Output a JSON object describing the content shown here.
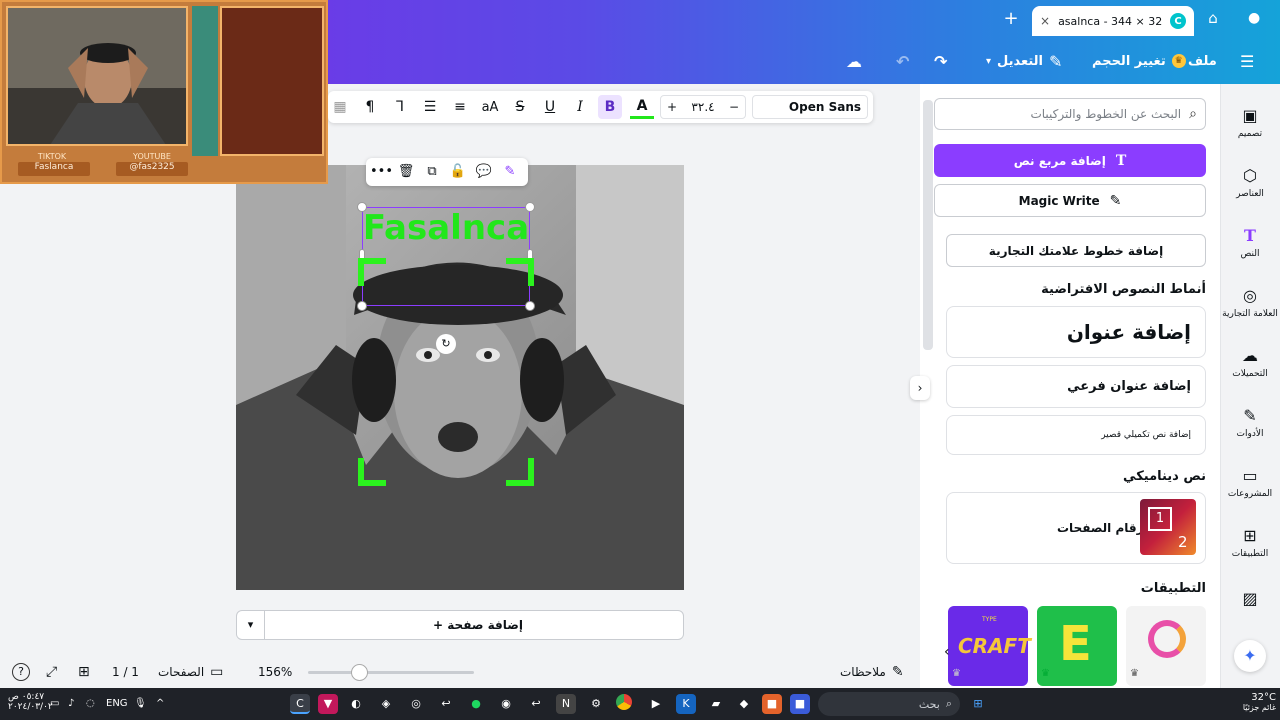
{
  "browser": {
    "tab_title": "asalnca - 344 × 326...",
    "new_tab": "+",
    "close": "×"
  },
  "topbar": {
    "file": "ملف",
    "resize": "تغيير الحجم",
    "edit": "التعديل"
  },
  "toolbar": {
    "font_name": "Open Sans",
    "font_size": "٣٢.٤",
    "minus": "−",
    "plus": "+",
    "text_color_glyph": "A",
    "bold_glyph": "B",
    "italic_glyph": "I",
    "underline_glyph": "U",
    "strike_glyph": "S",
    "case_glyph": "aA"
  },
  "canvas": {
    "brand_text": "Fasalnca",
    "add_page": "+ إضافة صفحة"
  },
  "bottombar": {
    "notes": "ملاحظات",
    "zoom": "156%",
    "pages_label": "الصفحات",
    "pages_count": "1 / 1"
  },
  "webcam": {
    "tiktok_label": "TIKTOK",
    "youtube_label": "YOUTUBE",
    "tiktok_name": "Faslanca",
    "youtube_name": "@fas2325"
  },
  "panel": {
    "search_placeholder": "البحث عن الخطوط والتركيبات",
    "add_textbox": "إضافة مربع نص",
    "magic_write": "Magic Write",
    "brand_fonts": "إضافة خطوط علامتك التجارية",
    "default_styles_title": "أنماط النصوص الافتراضية",
    "heading": "إضافة عنوان",
    "subheading": "إضافة عنوان فرعي",
    "body": "إضافة نص تكميلي قصير",
    "dynamic_title": "نص ديناميكي",
    "page_numbers": "أرقام الصفحات",
    "apps_title": "التطبيقات",
    "thumb_num_1": "1",
    "thumb_num_2": "2",
    "craft_label": "CRAFT",
    "craft_type": "TYPE",
    "e_label": "E"
  },
  "rail": {
    "design": "تصميم",
    "elements": "العناصر",
    "text": "النص",
    "brand": "العلامة التجارية",
    "uploads": "التحميلات",
    "tools": "الأدوات",
    "projects": "المشروعات",
    "apps": "التطبيقات"
  },
  "taskbar": {
    "search": "بحث",
    "lang": "ENG",
    "time": "٠٥:٤٧ ص",
    "date": "٢٠٢٤/٠٣/٠٢",
    "weather_temp": "32°C",
    "weather_desc": "غائم جزئيًا"
  },
  "colors": {
    "accent": "#8b3dff",
    "brand_green": "#22e71b"
  }
}
